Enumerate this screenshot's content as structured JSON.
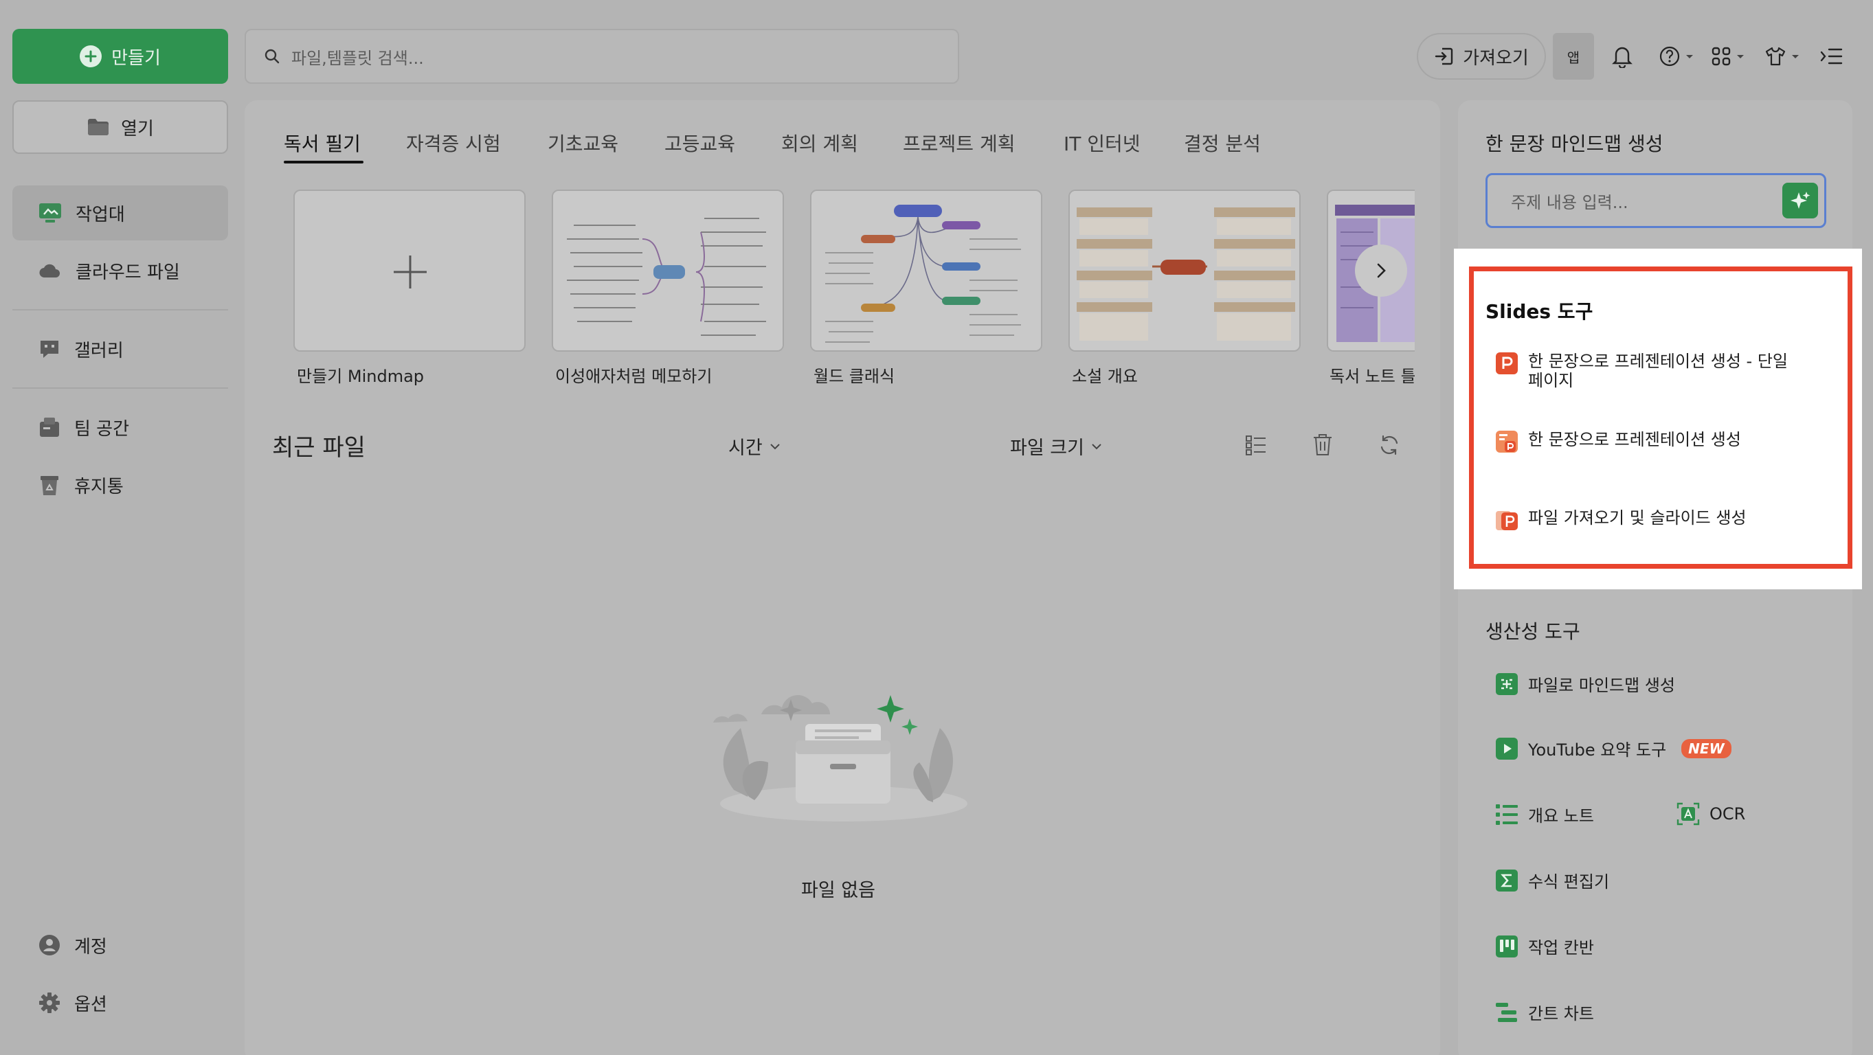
{
  "sidebar": {
    "create_label": "만들기",
    "open_label": "열기",
    "items": [
      {
        "label": "작업대",
        "icon": "workbench-icon"
      },
      {
        "label": "클라우드 파일",
        "icon": "cloud-icon"
      },
      {
        "label": "갤러리",
        "icon": "gallery-icon"
      },
      {
        "label": "팀 공간",
        "icon": "team-space-icon"
      },
      {
        "label": "휴지통",
        "icon": "trash-icon"
      }
    ],
    "account_label": "계정",
    "options_label": "옵션"
  },
  "topbar": {
    "search_placeholder": "파일,템플릿 검색...",
    "import_label": "가져오기",
    "app_label": "앱"
  },
  "main": {
    "tabs": [
      "독서 필기",
      "자격증 시험",
      "기초교육",
      "고등교육",
      "회의 계획",
      "프로젝트 계획",
      "IT 인터넷",
      "결정 분석"
    ],
    "active_tab": "독서 필기",
    "templates": [
      {
        "label": "만들기 Mindmap"
      },
      {
        "label": "이성애자처럼 메모하기"
      },
      {
        "label": "월드 클래식"
      },
      {
        "label": "소설 개요"
      },
      {
        "label": "독서 노트 틀"
      }
    ],
    "recent": {
      "title": "최근 파일",
      "sort_time": "시간",
      "sort_size": "파일 크기",
      "empty_text": "파일 없음"
    }
  },
  "right_panel": {
    "mindmap_title": "한 문장 마인드맵 생성",
    "topic_placeholder": "주제 내용 입력...",
    "slides": {
      "title": "Slides 도구",
      "tools": [
        {
          "line1": "한 문장으로 프레젠테이션 생성 - 단일",
          "line2": "페이지"
        },
        {
          "line1": "한 문장으로 프레젠테이션 생성",
          "line2": ""
        },
        {
          "line1": "파일 가져오기 및 슬라이드 생성",
          "line2": ""
        }
      ]
    },
    "productivity": {
      "title": "생산성 도구",
      "file_to_mindmap": "파일로 마인드맵 생성",
      "youtube": "YouTube 요약 도구",
      "new_badge": "NEW",
      "outline_note": "개요 노트",
      "ocr": "OCR",
      "formula": "수식 편집기",
      "kanban": "작업 칸반",
      "gantt": "간트 차트"
    }
  },
  "colors": {
    "accent_green": "#2f9350",
    "highlight_red": "#e8432d",
    "focus_blue": "#5a7fd0",
    "new_badge": "#e8613f"
  }
}
